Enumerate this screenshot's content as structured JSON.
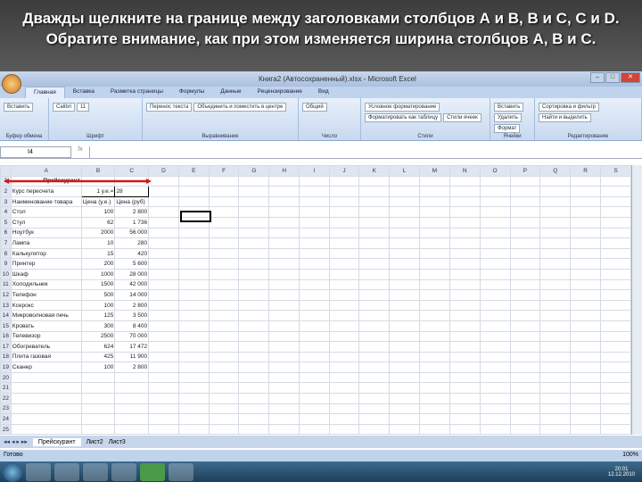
{
  "slide": {
    "title": "Дважды щелкните на границе между заголовками столбцов А и В, В и С, С и D. Обратите внимание, как при этом изменяется ширина столбцов А, В и С."
  },
  "window": {
    "title": "Книга2 (Автосохраненный).xlsx - Microsoft Excel"
  },
  "tabs": [
    "Главная",
    "Вставка",
    "Разметка страницы",
    "Формулы",
    "Данные",
    "Рецензирование",
    "Вид"
  ],
  "ribbon": {
    "groups": [
      {
        "label": "Буфер обмена",
        "items": [
          "Вставить"
        ]
      },
      {
        "label": "Шрифт",
        "items": [
          "Calibri",
          "11"
        ]
      },
      {
        "label": "Выравнивание",
        "items": [
          "Перенос текста",
          "Объединить и поместить в центре"
        ]
      },
      {
        "label": "Число",
        "items": [
          "Общий"
        ]
      },
      {
        "label": "Стили",
        "items": [
          "Условное форматирование",
          "Форматировать как таблицу",
          "Стили ячеек"
        ]
      },
      {
        "label": "Ячейки",
        "items": [
          "Вставить",
          "Удалить",
          "Формат"
        ]
      },
      {
        "label": "Редактирование",
        "items": [
          "Сортировка и фильтр",
          "Найти и выделить"
        ]
      }
    ]
  },
  "formula_bar": {
    "name_box": "I4",
    "fx": "fx"
  },
  "columns": [
    "A",
    "B",
    "C",
    "D",
    "E",
    "F",
    "G",
    "H",
    "I",
    "J",
    "K",
    "L",
    "M",
    "N",
    "O",
    "P",
    "Q",
    "R",
    "S"
  ],
  "rows": [
    [
      "Прейскурант",
      "",
      ""
    ],
    [
      "Курс пересчета",
      "1 у.е.=",
      "28"
    ],
    [
      "Наименование товара",
      "Цена (у.е.)",
      "Цена (руб)"
    ],
    [
      "Стол",
      "100",
      "2 800"
    ],
    [
      "Стул",
      "62",
      "1 736"
    ],
    [
      "Ноутбук",
      "2000",
      "56 000"
    ],
    [
      "Лампа",
      "10",
      "280"
    ],
    [
      "Калькулятор",
      "15",
      "420"
    ],
    [
      "Принтер",
      "200",
      "5 600"
    ],
    [
      "Шкаф",
      "1000",
      "28 000"
    ],
    [
      "Холодильник",
      "1500",
      "42 000"
    ],
    [
      "Телефон",
      "500",
      "14 000"
    ],
    [
      "Ксерокс",
      "100",
      "2 800"
    ],
    [
      "Микроволновая печь",
      "125",
      "3 500"
    ],
    [
      "Кровать",
      "300",
      "8 400"
    ],
    [
      "Телевизор",
      "2500",
      "70 000"
    ],
    [
      "Обогреватель",
      "624",
      "17 472"
    ],
    [
      "Плита газовая",
      "425",
      "11 900"
    ],
    [
      "Сканер",
      "100",
      "2 800"
    ],
    [
      "",
      "",
      ""
    ],
    [
      "",
      "",
      ""
    ],
    [
      "",
      "",
      ""
    ],
    [
      "",
      "",
      ""
    ],
    [
      "",
      "",
      ""
    ],
    [
      "",
      "",
      ""
    ]
  ],
  "sheets": [
    "Прейскурант",
    "Лист2",
    "Лист3"
  ],
  "status": {
    "ready": "Готово",
    "zoom": "100%"
  },
  "taskbar": {
    "time": "20:01",
    "date": "12.12.2010"
  }
}
